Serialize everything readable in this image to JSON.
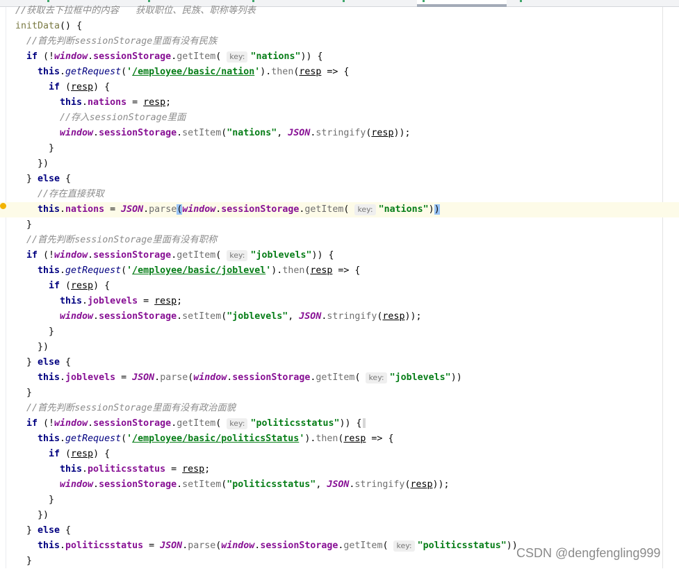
{
  "editor": {
    "highlight_line": 13,
    "lines": [
      {
        "indent": 0,
        "t": [
          [
            "cm",
            "//获取去下拉框中的内容   获取职位、民族、职称等列表"
          ]
        ]
      },
      {
        "indent": 0,
        "t": [
          [
            "decl",
            "initData"
          ],
          [
            "p",
            "() {"
          ]
        ]
      },
      {
        "indent": 1,
        "t": [
          [
            "cm",
            "//首先判断sessionStorage里面有没有民族"
          ]
        ]
      },
      {
        "indent": 1,
        "t": [
          [
            "kw",
            "if"
          ],
          [
            "p",
            " (!"
          ],
          [
            "glob",
            "window"
          ],
          [
            "p",
            "."
          ],
          [
            "prop",
            "sessionStorage"
          ],
          [
            "p",
            "."
          ],
          [
            "fn",
            "getItem"
          ],
          [
            "p",
            "( "
          ],
          [
            "hint",
            "key:"
          ],
          [
            "str",
            "\"nations\""
          ],
          [
            "p",
            ")) {"
          ]
        ]
      },
      {
        "indent": 2,
        "t": [
          [
            "this",
            "this"
          ],
          [
            "p",
            "."
          ],
          [
            "call",
            "getRequest"
          ],
          [
            "p",
            "("
          ],
          [
            "str",
            "'"
          ],
          [
            "url",
            "/employee/basic/nation"
          ],
          [
            "str",
            "'"
          ],
          [
            "p",
            ")."
          ],
          [
            "fn",
            "then"
          ],
          [
            "p",
            "("
          ],
          [
            "var",
            "resp"
          ],
          [
            "p",
            " => {"
          ]
        ]
      },
      {
        "indent": 3,
        "t": [
          [
            "kw",
            "if"
          ],
          [
            "p",
            " ("
          ],
          [
            "var",
            "resp"
          ],
          [
            "p",
            ") {"
          ]
        ]
      },
      {
        "indent": 4,
        "t": [
          [
            "this",
            "this"
          ],
          [
            "p",
            "."
          ],
          [
            "prop",
            "nations"
          ],
          [
            "p",
            " = "
          ],
          [
            "var",
            "resp"
          ],
          [
            "p",
            ";"
          ]
        ]
      },
      {
        "indent": 4,
        "t": [
          [
            "cm",
            "//存入sessionStorage里面"
          ]
        ]
      },
      {
        "indent": 4,
        "t": [
          [
            "glob",
            "window"
          ],
          [
            "p",
            "."
          ],
          [
            "prop",
            "sessionStorage"
          ],
          [
            "p",
            "."
          ],
          [
            "fn",
            "setItem"
          ],
          [
            "p",
            "("
          ],
          [
            "str",
            "\"nations\""
          ],
          [
            "p",
            ", "
          ],
          [
            "glob",
            "JSON"
          ],
          [
            "p",
            "."
          ],
          [
            "fn",
            "stringify"
          ],
          [
            "p",
            "("
          ],
          [
            "var",
            "resp"
          ],
          [
            "p",
            "));"
          ]
        ]
      },
      {
        "indent": 3,
        "t": [
          [
            "p",
            "}"
          ]
        ]
      },
      {
        "indent": 2,
        "t": [
          [
            "p",
            "})"
          ]
        ]
      },
      {
        "indent": 1,
        "t": [
          [
            "p",
            "} "
          ],
          [
            "kw",
            "else"
          ],
          [
            "p",
            " {"
          ]
        ]
      },
      {
        "indent": 2,
        "t": [
          [
            "cm",
            "//存在直接获取"
          ]
        ]
      },
      {
        "indent": 2,
        "t": [
          [
            "this",
            "this"
          ],
          [
            "p",
            "."
          ],
          [
            "prop",
            "nations"
          ],
          [
            "p",
            " = "
          ],
          [
            "glob",
            "JSON"
          ],
          [
            "p",
            "."
          ],
          [
            "fn",
            "parse"
          ],
          [
            "brace",
            "("
          ],
          [
            "glob",
            "window"
          ],
          [
            "p",
            "."
          ],
          [
            "prop",
            "sessionStorage"
          ],
          [
            "p",
            "."
          ],
          [
            "fn",
            "getItem"
          ],
          [
            "p",
            "( "
          ],
          [
            "hint",
            "key:"
          ],
          [
            "str",
            "\"nations\""
          ],
          [
            "p",
            ")"
          ],
          [
            "brace",
            ")"
          ]
        ]
      },
      {
        "indent": 1,
        "t": [
          [
            "p",
            "}"
          ]
        ]
      },
      {
        "indent": 1,
        "t": [
          [
            "cm",
            "//首先判断sessionStorage里面有没有职称"
          ]
        ]
      },
      {
        "indent": 1,
        "t": [
          [
            "kw",
            "if"
          ],
          [
            "p",
            " (!"
          ],
          [
            "glob",
            "window"
          ],
          [
            "p",
            "."
          ],
          [
            "prop",
            "sessionStorage"
          ],
          [
            "p",
            "."
          ],
          [
            "fn",
            "getItem"
          ],
          [
            "p",
            "( "
          ],
          [
            "hint",
            "key:"
          ],
          [
            "str",
            "\"joblevels\""
          ],
          [
            "p",
            ")) {"
          ]
        ]
      },
      {
        "indent": 2,
        "t": [
          [
            "this",
            "this"
          ],
          [
            "p",
            "."
          ],
          [
            "call",
            "getRequest"
          ],
          [
            "p",
            "("
          ],
          [
            "str",
            "'"
          ],
          [
            "url",
            "/employee/basic/joblevel"
          ],
          [
            "str",
            "'"
          ],
          [
            "p",
            ")."
          ],
          [
            "fn",
            "then"
          ],
          [
            "p",
            "("
          ],
          [
            "var",
            "resp"
          ],
          [
            "p",
            " => {"
          ]
        ]
      },
      {
        "indent": 3,
        "t": [
          [
            "kw",
            "if"
          ],
          [
            "p",
            " ("
          ],
          [
            "var",
            "resp"
          ],
          [
            "p",
            ") {"
          ]
        ]
      },
      {
        "indent": 4,
        "t": [
          [
            "this",
            "this"
          ],
          [
            "p",
            "."
          ],
          [
            "prop",
            "joblevels"
          ],
          [
            "p",
            " = "
          ],
          [
            "var",
            "resp"
          ],
          [
            "p",
            ";"
          ]
        ]
      },
      {
        "indent": 4,
        "t": [
          [
            "glob",
            "window"
          ],
          [
            "p",
            "."
          ],
          [
            "prop",
            "sessionStorage"
          ],
          [
            "p",
            "."
          ],
          [
            "fn",
            "setItem"
          ],
          [
            "p",
            "("
          ],
          [
            "str",
            "\"joblevels\""
          ],
          [
            "p",
            ", "
          ],
          [
            "glob",
            "JSON"
          ],
          [
            "p",
            "."
          ],
          [
            "fn",
            "stringify"
          ],
          [
            "p",
            "("
          ],
          [
            "var",
            "resp"
          ],
          [
            "p",
            "));"
          ]
        ]
      },
      {
        "indent": 3,
        "t": [
          [
            "p",
            "}"
          ]
        ]
      },
      {
        "indent": 2,
        "t": [
          [
            "p",
            "})"
          ]
        ]
      },
      {
        "indent": 1,
        "t": [
          [
            "p",
            "} "
          ],
          [
            "kw",
            "else"
          ],
          [
            "p",
            " {"
          ]
        ]
      },
      {
        "indent": 2,
        "t": [
          [
            "this",
            "this"
          ],
          [
            "p",
            "."
          ],
          [
            "prop",
            "joblevels"
          ],
          [
            "p",
            " = "
          ],
          [
            "glob",
            "JSON"
          ],
          [
            "p",
            "."
          ],
          [
            "fn",
            "parse"
          ],
          [
            "p",
            "("
          ],
          [
            "glob",
            "window"
          ],
          [
            "p",
            "."
          ],
          [
            "prop",
            "sessionStorage"
          ],
          [
            "p",
            "."
          ],
          [
            "fn",
            "getItem"
          ],
          [
            "p",
            "( "
          ],
          [
            "hint",
            "key:"
          ],
          [
            "str",
            "\"joblevels\""
          ],
          [
            "p",
            "))"
          ]
        ]
      },
      {
        "indent": 1,
        "t": [
          [
            "p",
            "}"
          ]
        ]
      },
      {
        "indent": 1,
        "t": [
          [
            "cm",
            "//首先判断sessionStorage里面有没有政治面貌"
          ]
        ]
      },
      {
        "indent": 1,
        "t": [
          [
            "kw",
            "if"
          ],
          [
            "p",
            " (!"
          ],
          [
            "glob",
            "window"
          ],
          [
            "p",
            "."
          ],
          [
            "prop",
            "sessionStorage"
          ],
          [
            "p",
            "."
          ],
          [
            "fn",
            "getItem"
          ],
          [
            "p",
            "( "
          ],
          [
            "hint",
            "key:"
          ],
          [
            "str",
            "\"politicsstatus\""
          ],
          [
            "p",
            ")) {"
          ]
        ]
      },
      {
        "indent": 2,
        "t": [
          [
            "this",
            "this"
          ],
          [
            "p",
            "."
          ],
          [
            "call",
            "getRequest"
          ],
          [
            "p",
            "("
          ],
          [
            "str",
            "'"
          ],
          [
            "url",
            "/employee/basic/politicsStatus"
          ],
          [
            "str",
            "'"
          ],
          [
            "p",
            ")."
          ],
          [
            "fn",
            "then"
          ],
          [
            "p",
            "("
          ],
          [
            "var",
            "resp"
          ],
          [
            "p",
            " => {"
          ]
        ]
      },
      {
        "indent": 3,
        "t": [
          [
            "kw",
            "if"
          ],
          [
            "p",
            " ("
          ],
          [
            "var",
            "resp"
          ],
          [
            "p",
            ") {"
          ]
        ]
      },
      {
        "indent": 4,
        "t": [
          [
            "this",
            "this"
          ],
          [
            "p",
            "."
          ],
          [
            "prop",
            "politicsstatus"
          ],
          [
            "p",
            " = "
          ],
          [
            "var",
            "resp"
          ],
          [
            "p",
            ";"
          ]
        ]
      },
      {
        "indent": 4,
        "t": [
          [
            "glob",
            "window"
          ],
          [
            "p",
            "."
          ],
          [
            "prop",
            "sessionStorage"
          ],
          [
            "p",
            "."
          ],
          [
            "fn",
            "setItem"
          ],
          [
            "p",
            "("
          ],
          [
            "str",
            "\"politicsstatus\""
          ],
          [
            "p",
            ", "
          ],
          [
            "glob",
            "JSON"
          ],
          [
            "p",
            "."
          ],
          [
            "fn",
            "stringify"
          ],
          [
            "p",
            "("
          ],
          [
            "var",
            "resp"
          ],
          [
            "p",
            "));"
          ]
        ]
      },
      {
        "indent": 3,
        "t": [
          [
            "p",
            "}"
          ]
        ]
      },
      {
        "indent": 2,
        "t": [
          [
            "p",
            "})"
          ]
        ]
      },
      {
        "indent": 1,
        "t": [
          [
            "p",
            "} "
          ],
          [
            "kw",
            "else"
          ],
          [
            "p",
            " {"
          ]
        ]
      },
      {
        "indent": 2,
        "t": [
          [
            "this",
            "this"
          ],
          [
            "p",
            "."
          ],
          [
            "prop",
            "politicsstatus"
          ],
          [
            "p",
            " = "
          ],
          [
            "glob",
            "JSON"
          ],
          [
            "p",
            "."
          ],
          [
            "fn",
            "parse"
          ],
          [
            "p",
            "("
          ],
          [
            "glob",
            "window"
          ],
          [
            "p",
            "."
          ],
          [
            "prop",
            "sessionStorage"
          ],
          [
            "p",
            "."
          ],
          [
            "fn",
            "getItem"
          ],
          [
            "p",
            "( "
          ],
          [
            "hint",
            "key:"
          ],
          [
            "str",
            "\"politicsstatus\""
          ],
          [
            "p",
            "))"
          ]
        ]
      },
      {
        "indent": 1,
        "t": [
          [
            "p",
            "}"
          ]
        ]
      }
    ]
  },
  "watermark": "CSDN @dengfengling999"
}
